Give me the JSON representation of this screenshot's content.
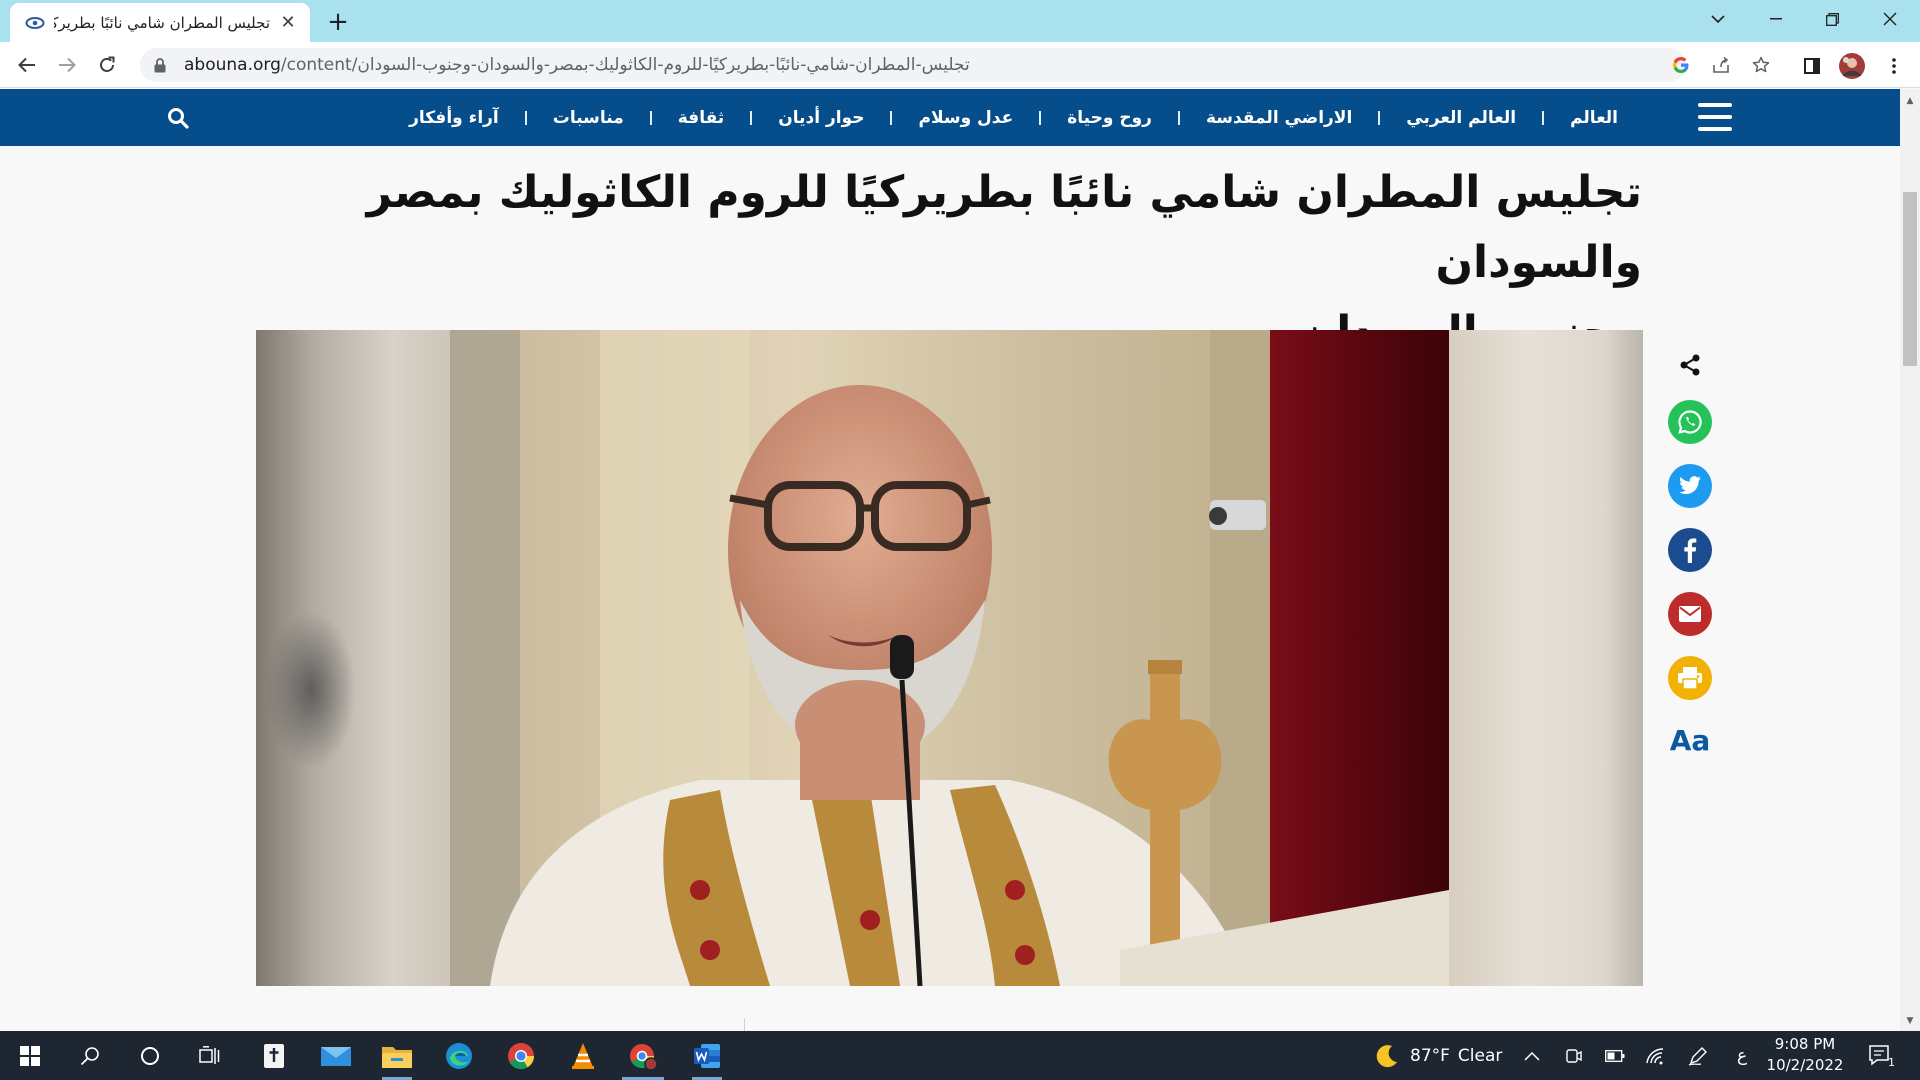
{
  "browser": {
    "tab_title": "تجليس المطران شامي نائبًا بطريركيًا",
    "url_domain": "abouna.org",
    "url_path": "/content/تجليس-المطران-شامي-نائبًا-بطريركيًا-للروم-الكاثوليك-بمصر-والسودان-وجنوب-السودان",
    "new_tab_symbol": "+",
    "close_symbol": "✕"
  },
  "site": {
    "nav_links": [
      "العالم",
      "العالم العربي",
      "الاراضي المقدسة",
      "روح وحياة",
      "عدل وسلام",
      "حوار أديان",
      "ثقافة",
      "مناسبات",
      "آراء وأفكار"
    ],
    "icons": {
      "menu": "hamburger-icon",
      "search": "search-icon"
    },
    "colors": {
      "nav_bg": "#064d8c",
      "whatsapp": "#25c25a",
      "twitter": "#1d9bf0",
      "facebook": "#1a4c8f",
      "email": "#bd2c2c",
      "print": "#f2b205",
      "font_size": "#0b5aa0"
    }
  },
  "article": {
    "headline_line1": "تجليس المطران شامي نائبًا بطريركيًا للروم الكاثوليك بمصر والسودان",
    "headline_line2": "وجنوب السودان"
  },
  "share": {
    "font_size_label": "Aa"
  },
  "taskbar": {
    "weather_temp": "87°F",
    "weather_cond": "Clear",
    "language": "ع",
    "time": "9:08 PM",
    "date": "10/2/2022",
    "notifications_count": "1"
  }
}
